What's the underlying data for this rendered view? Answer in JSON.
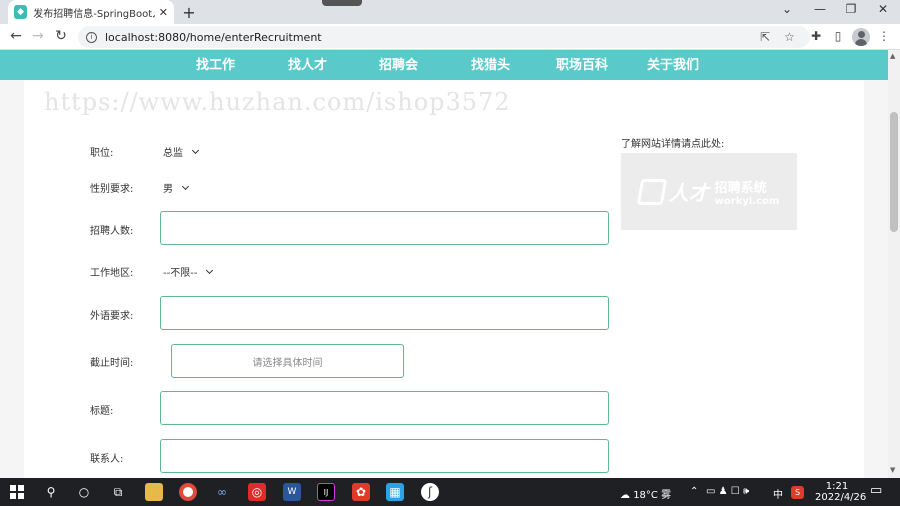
{
  "browser": {
    "tab_title": "发布招聘信息-SpringBoot人才招聘",
    "new_tab": "+",
    "tab_close": "✕",
    "url": "localhost:8080/home/enterRecruitment"
  },
  "nav": {
    "items": [
      "找工作",
      "找人才",
      "招聘会",
      "找猎头",
      "职场百科",
      "关于我们"
    ]
  },
  "watermark": "https://www.huzhan.com/ishop3572",
  "form": {
    "position_label": "职位:",
    "position_value": "总监",
    "gender_label": "性别要求:",
    "gender_value": "男",
    "count_label": "招聘人数:",
    "region_label": "工作地区:",
    "region_value": "--不限--",
    "language_label": "外语要求:",
    "deadline_label": "截止时间:",
    "deadline_placeholder": "请选择具体时间",
    "title_label": "标题:",
    "contact_label": "联系人:"
  },
  "sidebar": {
    "label": "了解网站详情请点此处:",
    "logo_cn_text": "人才",
    "logo_right_cn": "招聘系统",
    "logo_right_en": "workyi.com"
  },
  "taskbar": {
    "weather": "18°C 雾",
    "ime": "中",
    "time": "1:21",
    "date": "2022/4/26"
  },
  "colors": {
    "navbar": "#5ac9c9",
    "input_border": "#5fb88f"
  }
}
